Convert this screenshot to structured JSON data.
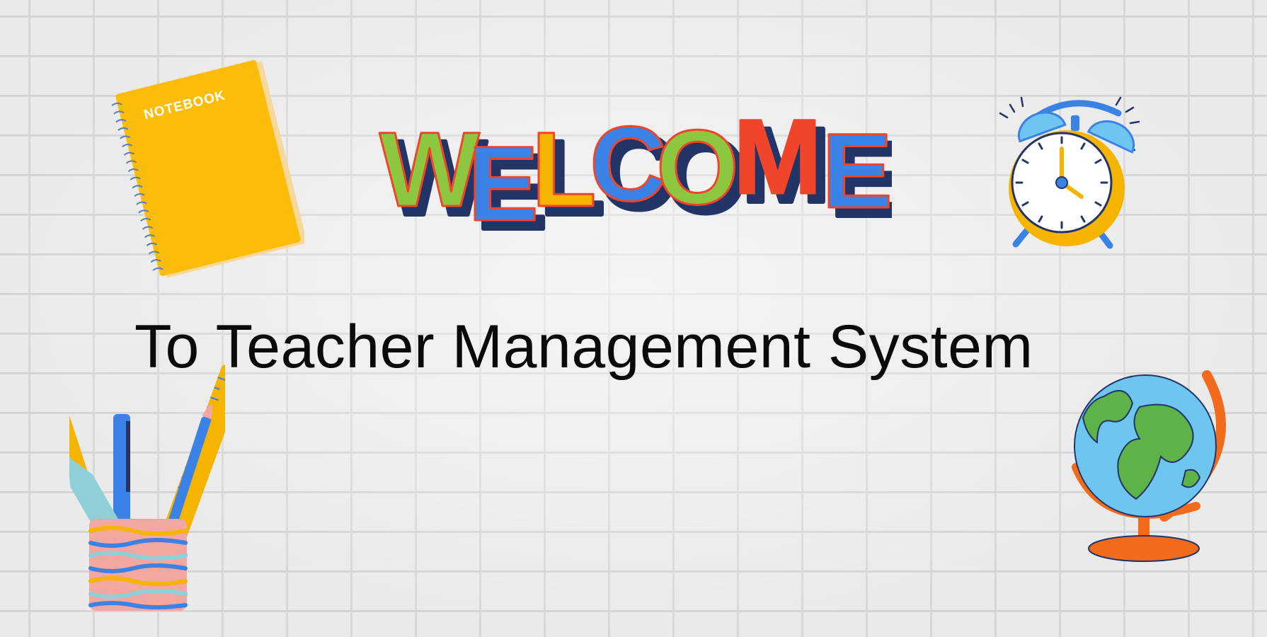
{
  "welcome_banner": {
    "letters": [
      "W",
      "E",
      "L",
      "C",
      "O",
      "M",
      "E"
    ],
    "colors": [
      "#8dc63f",
      "#3b82e6",
      "#f5b400",
      "#3b82e6",
      "#8dc63f",
      "#f0452a",
      "#3b82e6"
    ]
  },
  "tagline": "To Teacher Management System",
  "notebook": {
    "cover_text": "NOTEBOOK",
    "cover_color": "#fbbd0a"
  },
  "decorations": {
    "clock_icon": "alarm-clock-icon",
    "pencil_cup_icon": "pencil-cup-icon",
    "globe_icon": "globe-icon"
  },
  "colors": {
    "wall": "#e9e9e9",
    "text": "#0a0a0a",
    "outline": "#233566"
  }
}
